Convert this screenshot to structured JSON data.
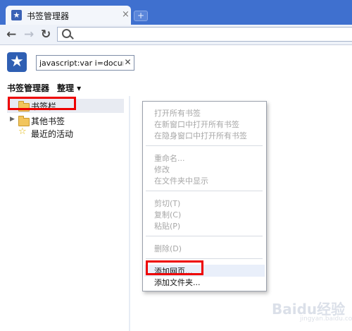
{
  "browser": {
    "tab_title": "书签管理器",
    "tab_close": "×",
    "new_tab": "+",
    "back": "←",
    "forward": "→",
    "reload": "↻",
    "omnibox_value": ""
  },
  "header": {
    "logo_icon": "star-icon",
    "search_value": "javascript:var i=documen",
    "search_clear": "✕"
  },
  "menubar": {
    "manager_label": "书签管理器",
    "organize_label": "整理 ▾"
  },
  "tree": {
    "items": [
      {
        "label": "书签栏",
        "icon": "folder-icon"
      },
      {
        "label": "其他书签",
        "icon": "folder-icon"
      },
      {
        "label": "最近的活动",
        "icon": "star-icon"
      }
    ],
    "expand_arrow": "▶"
  },
  "context_menu": {
    "groups": [
      [
        "打开所有书签",
        "在新窗口中打开所有书签",
        "在隐身窗口中打开所有书签"
      ],
      [
        "重命名...",
        "修改",
        "在文件夹中显示"
      ],
      [
        "剪切(T)",
        "复制(C)",
        "粘贴(P)"
      ],
      [
        "删除(D)"
      ],
      [
        "添加网页...",
        "添加文件夹..."
      ]
    ]
  },
  "watermark": {
    "line1": "Baidu经验",
    "line2": "jingyan.baidu.com"
  }
}
